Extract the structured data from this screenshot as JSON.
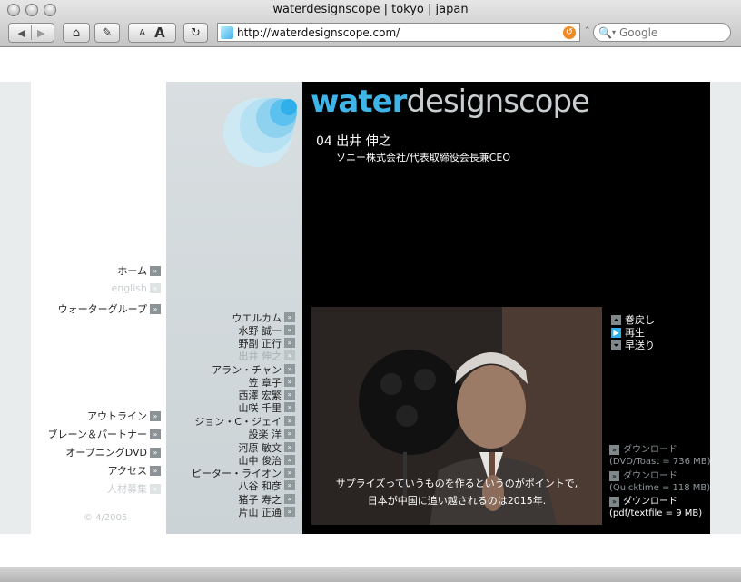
{
  "browser": {
    "window_title": "waterdesignscope | tokyo | japan",
    "url": "http://waterdesignscope.com/",
    "search_placeholder": "Google",
    "text_smaller": "A",
    "text_bigger": "A"
  },
  "logo": {
    "part1": "water",
    "part2": "designscope"
  },
  "speaker": {
    "name": "04 出井 伸之",
    "title": "ソニー株式会社/代表取締役会長兼CEO"
  },
  "nav_top": [
    {
      "label": "ホーム",
      "dim": false
    },
    {
      "label": "english",
      "dim": true
    },
    {
      "label": "ウォーターグループ",
      "dim": false
    }
  ],
  "nav_bottom": [
    {
      "label": "アウトライン",
      "dim": false
    },
    {
      "label": "ブレーン＆パートナー",
      "dim": false
    },
    {
      "label": "オープニングDVD",
      "dim": false
    },
    {
      "label": "アクセス",
      "dim": false
    },
    {
      "label": "人材募集",
      "dim": true
    }
  ],
  "copyright": "© 4/2005",
  "names": [
    {
      "label": "ウエルカム",
      "current": false
    },
    {
      "label": "水野 誠一",
      "current": false
    },
    {
      "label": "野副 正行",
      "current": false
    },
    {
      "label": "出井 伸之",
      "current": true
    },
    {
      "label": "アラン・チャン",
      "current": false
    },
    {
      "label": "笠 章子",
      "current": false
    },
    {
      "label": "西澤 宏繁",
      "current": false
    },
    {
      "label": "山咲 千里",
      "current": false
    },
    {
      "label": "ジョン・C・ジェイ",
      "current": false
    },
    {
      "label": "設楽 洋",
      "current": false
    },
    {
      "label": "河原 敏文",
      "current": false
    },
    {
      "label": "山中 俊治",
      "current": false
    },
    {
      "label": "ピーター・ライオン",
      "current": false
    },
    {
      "label": "八谷 和彦",
      "current": false
    },
    {
      "label": "猪子 寿之",
      "current": false
    },
    {
      "label": "片山 正通",
      "current": false
    }
  ],
  "video": {
    "subtitle_line1": "サプライズっていうものを作るというのがポイントで,",
    "subtitle_line2": "日本が中国に追い越されるのは2015年."
  },
  "controls": {
    "rewind": "巻戻し",
    "play": "再生",
    "forward": "早送り"
  },
  "downloads": [
    {
      "label": "ダウンロード",
      "detail": "(DVD/Toast = 736 MB)",
      "highlight": false
    },
    {
      "label": "ダウンロード",
      "detail": "(Quicktime = 118 MB)",
      "highlight": false
    },
    {
      "label": "ダウンロード",
      "detail": "(pdf/textfile = 9 MB)",
      "highlight": true
    }
  ],
  "colors": {
    "accent_blue": "#3fb4e8",
    "main_bg": "#000000",
    "side_bg": "#d4dbdd"
  }
}
